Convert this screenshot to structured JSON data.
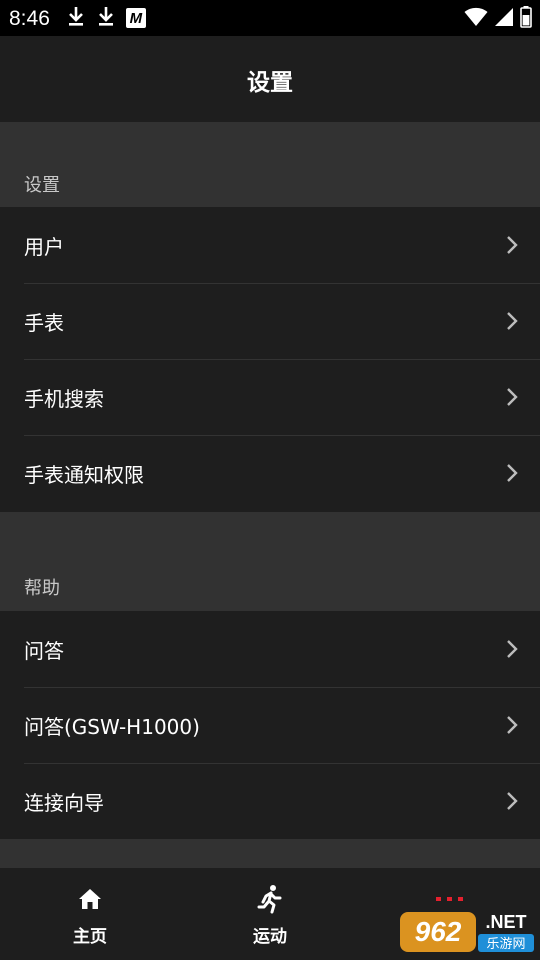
{
  "status_bar": {
    "time": "8:46",
    "left_icons": [
      "download-icon",
      "download-icon",
      "m-notification-icon"
    ],
    "m_badge": "M",
    "right_icons": [
      "wifi-icon",
      "signal-icon",
      "battery-icon"
    ]
  },
  "app_bar": {
    "title": "设置"
  },
  "sections": [
    {
      "header": "设置",
      "items": [
        "用户",
        "手表",
        "手机搜索",
        "手表通知权限"
      ]
    },
    {
      "header": "帮助",
      "items": [
        "问答",
        "问答(GSW-H1000)",
        "连接向导"
      ]
    }
  ],
  "bottom_nav": {
    "items": [
      {
        "label": "主页",
        "icon": "home-icon"
      },
      {
        "label": "运动",
        "icon": "running-icon"
      },
      {
        "label": "",
        "icon": "more-icon"
      }
    ]
  },
  "watermark": {
    "brand": "962.NET",
    "sub": "乐游网"
  },
  "colors": {
    "background": "#323232",
    "surface": "#1e1e1e",
    "divider": "#333333",
    "text_primary": "#ffffff",
    "text_secondary": "#c8c8c8",
    "accent_red": "#e5202e"
  }
}
